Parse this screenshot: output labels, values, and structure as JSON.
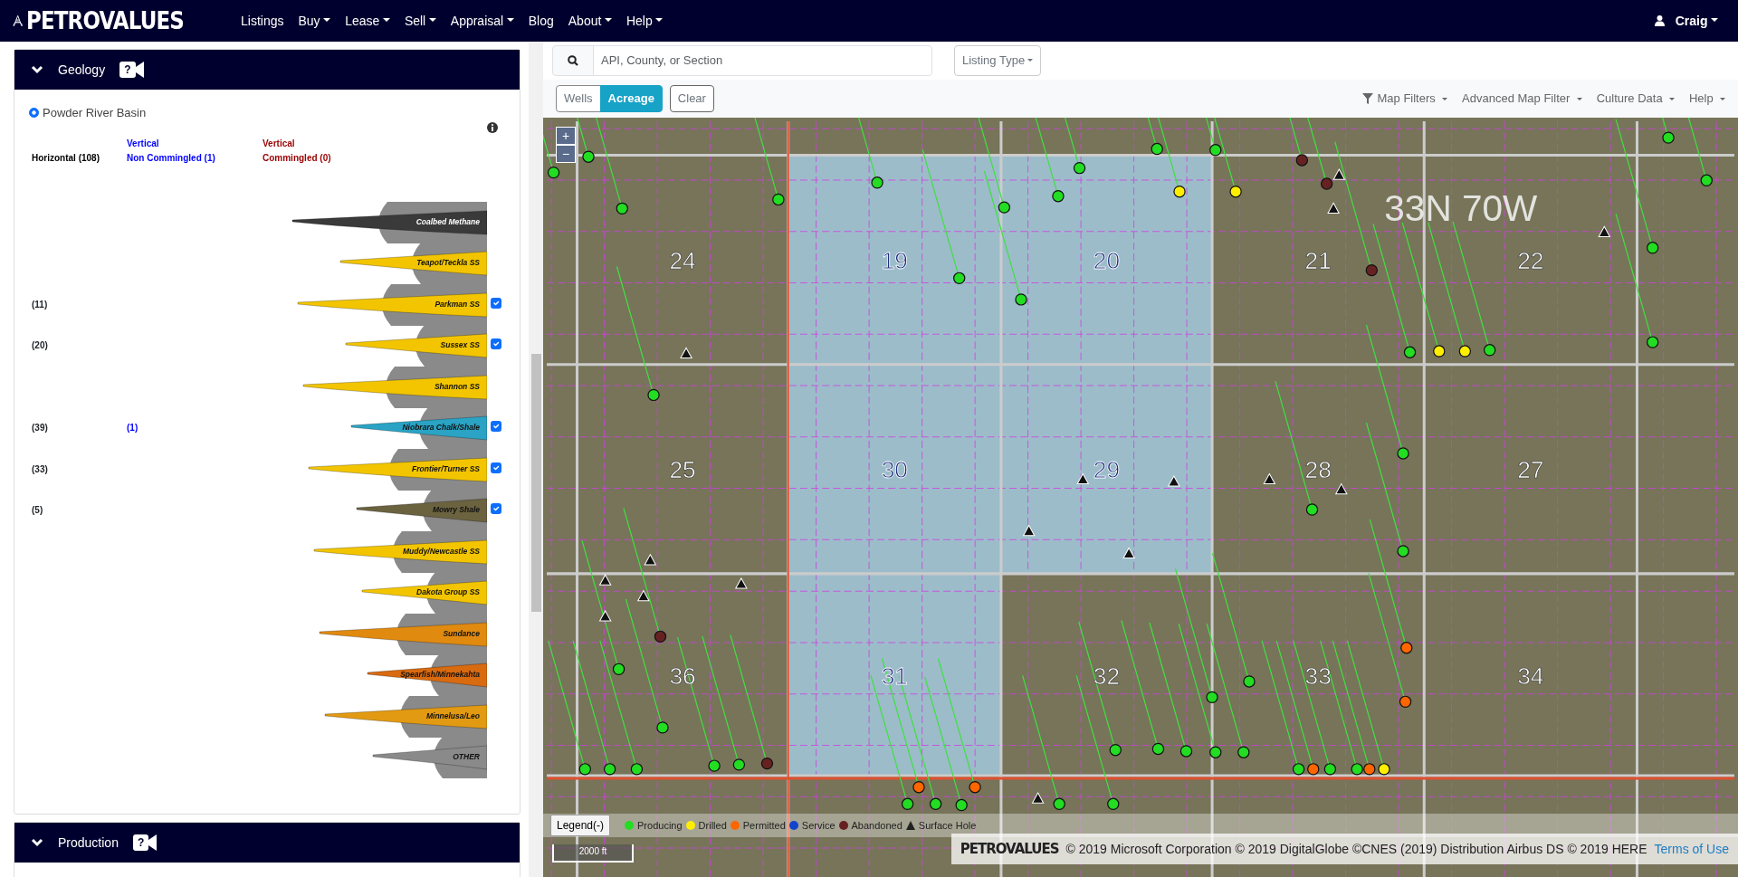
{
  "navbar": {
    "brand": "PETROVALUES",
    "menu": [
      {
        "label": "Listings",
        "dropdown": false
      },
      {
        "label": "Buy",
        "dropdown": true
      },
      {
        "label": "Lease",
        "dropdown": true
      },
      {
        "label": "Sell",
        "dropdown": true
      },
      {
        "label": "Appraisal",
        "dropdown": true
      },
      {
        "label": "Blog",
        "dropdown": false
      },
      {
        "label": "About",
        "dropdown": true
      },
      {
        "label": "Help",
        "dropdown": true
      }
    ],
    "user": "Craig"
  },
  "geology": {
    "title": "Geology",
    "help_badge": "?",
    "expanded": true,
    "basin": {
      "label": "Powder River Basin",
      "selected": true
    },
    "columns": [
      {
        "lines": [
          "Horizontal (108)"
        ],
        "color": "#000000"
      },
      {
        "lines": [
          "Vertical",
          "Non Commingled (1)"
        ],
        "color": "#0000ff"
      },
      {
        "lines": [
          "Vertical",
          "Commingled (0)"
        ],
        "color": "#990000"
      }
    ],
    "layers": [
      {
        "name": "Coalbed Methane",
        "color": "#3a3a3a",
        "kind": "plain"
      },
      {
        "name": "Teapot/Teckla SS",
        "color": "#f2c500",
        "kind": "plain"
      },
      {
        "name": "Parkman SS",
        "color": "#f2c500",
        "kind": "target",
        "horizontal": "(11)",
        "checked": true
      },
      {
        "name": "Sussex SS",
        "color": "#f2c500",
        "kind": "target",
        "horizontal": "(20)",
        "checked": true
      },
      {
        "name": "Shannon SS",
        "color": "#f2c500",
        "kind": "plain"
      },
      {
        "name": "Niobrara Chalk/Shale",
        "color": "#2aa3c4",
        "kind": "target",
        "horizontal": "(39)",
        "vertical": "(1)",
        "checked": true
      },
      {
        "name": "Frontier/Turner SS",
        "color": "#f2c500",
        "kind": "target",
        "horizontal": "(33)",
        "checked": true
      },
      {
        "name": "Mowry Shale",
        "color": "#6b6240",
        "kind": "target",
        "horizontal": "(5)",
        "checked": true
      },
      {
        "name": "Muddy/Newcastle SS",
        "color": "#f2c500",
        "kind": "plain"
      },
      {
        "name": "Dakota Group SS",
        "color": "#f2c500",
        "kind": "plain"
      },
      {
        "name": "Sundance",
        "color": "#e08a10",
        "kind": "plain"
      },
      {
        "name": "Spearfish/Minnekahta",
        "color": "#d86a10",
        "kind": "plain"
      },
      {
        "name": "Minnelusa/Leo",
        "color": "#e29a12",
        "kind": "plain"
      },
      {
        "name": "OTHER",
        "color": "#8a8a8a",
        "kind": "plain"
      }
    ]
  },
  "production": {
    "title": "Production",
    "help_badge": "?",
    "expanded": true
  },
  "map": {
    "search_placeholder": "API, County, or Section",
    "listing_type": "Listing Type",
    "view_toggle": [
      {
        "label": "Wells",
        "selected": false
      },
      {
        "label": "Acreage",
        "selected": true
      }
    ],
    "clear": "Clear",
    "menus": [
      {
        "label": "Map Filters",
        "kind": "filter"
      },
      {
        "label": "Advanced Map Filter",
        "kind": "plain"
      },
      {
        "label": "Culture Data",
        "kind": "plain"
      },
      {
        "label": "Help",
        "kind": "plain"
      }
    ],
    "zoom_in": "+",
    "zoom_out": "−",
    "township": "33N 70W",
    "sections": [
      {
        "label": "24",
        "acreage": false
      },
      {
        "label": "19",
        "acreage": true
      },
      {
        "label": "20",
        "acreage": true
      },
      {
        "label": "21",
        "acreage": false
      },
      {
        "label": "22",
        "acreage": false
      },
      {
        "label": "25",
        "acreage": false
      },
      {
        "label": "30",
        "acreage": true
      },
      {
        "label": "29",
        "acreage": true
      },
      {
        "label": "28",
        "acreage": false
      },
      {
        "label": "27",
        "acreage": false
      },
      {
        "label": "36",
        "acreage": false
      },
      {
        "label": "31",
        "acreage": true
      },
      {
        "label": "32",
        "acreage": false
      },
      {
        "label": "33",
        "acreage": false
      },
      {
        "label": "34",
        "acreage": false
      }
    ],
    "wells": [
      {
        "color": "#22dd22"
      },
      {
        "color": "#22dd22"
      },
      {
        "color": "#22dd22"
      },
      {
        "color": "#22dd22"
      },
      {
        "color": "#22dd22"
      },
      {
        "color": "#22dd22"
      },
      {
        "color": "#22dd22"
      },
      {
        "color": "#22dd22"
      },
      {
        "color": "#22dd22"
      },
      {
        "color": "#22dd22"
      },
      {
        "color": "#22dd22"
      },
      {
        "color": "#22dd22"
      },
      {
        "color": "#662222"
      },
      {
        "color": "#662222"
      },
      {
        "color": "#22dd22"
      },
      {
        "color": "#22dd22"
      },
      {
        "color": "#22dd22"
      },
      {
        "color": "#22dd22"
      },
      {
        "color": "#22dd22"
      },
      {
        "color": "#22dd22"
      },
      {
        "color": "#ffee00"
      },
      {
        "color": "#ffee00"
      },
      {
        "color": "#662222"
      },
      {
        "color": "#662222"
      },
      {
        "color": "#662222"
      },
      {
        "color": "#22dd22"
      },
      {
        "color": "#ffee00"
      },
      {
        "color": "#ffee00"
      },
      {
        "color": "#22dd22"
      },
      {
        "color": "#22dd22"
      },
      {
        "color": "#22dd22"
      },
      {
        "color": "#22dd22"
      },
      {
        "color": "#ff6600"
      },
      {
        "color": "#ff6600"
      },
      {
        "color": "#ff6600"
      },
      {
        "color": "#ff6600"
      },
      {
        "color": "#ffee00"
      },
      {
        "color": "#22dd22"
      },
      {
        "color": "#22dd22"
      },
      {
        "color": "#22dd22"
      },
      {
        "color": "#22dd22"
      },
      {
        "color": "#22dd22"
      },
      {
        "color": "#22dd22"
      },
      {
        "color": "#22dd22"
      },
      {
        "color": "#22dd22"
      },
      {
        "color": "#22dd22"
      },
      {
        "color": "#22dd22"
      },
      {
        "color": "#ff6600"
      },
      {
        "color": "#ff6600"
      },
      {
        "color": "#22dd22"
      },
      {
        "color": "#22dd22"
      },
      {
        "color": "#22dd22"
      },
      {
        "color": "#22dd22"
      },
      {
        "color": "#22dd22"
      },
      {
        "color": "#22dd22"
      },
      {
        "color": "#22dd22"
      },
      {
        "color": "#22dd22"
      },
      {
        "color": "#22dd22"
      },
      {
        "color": "#22dd22"
      },
      {
        "color": "#22dd22"
      }
    ],
    "legend": {
      "button": "Legend(-)",
      "items": [
        {
          "label": "Producing",
          "color": "#22dd22",
          "kind": "dot"
        },
        {
          "label": "Drilled",
          "color": "#ffee00",
          "kind": "dot"
        },
        {
          "label": "Permitted",
          "color": "#ff6600",
          "kind": "dot"
        },
        {
          "label": "Service",
          "color": "#1144cc",
          "kind": "dot"
        },
        {
          "label": "Abandoned",
          "color": "#662222",
          "kind": "dot"
        },
        {
          "label": "Surface Hole",
          "kind": "triangle"
        }
      ]
    },
    "scale": "2000 ft",
    "attribution": {
      "logo": "PETROVALUES",
      "text": "© 2019 Microsoft Corporation © 2019 DigitalGlobe ©CNES (2019) Distribution Airbus DS © 2019 HERE",
      "link": "Terms of Use"
    }
  }
}
